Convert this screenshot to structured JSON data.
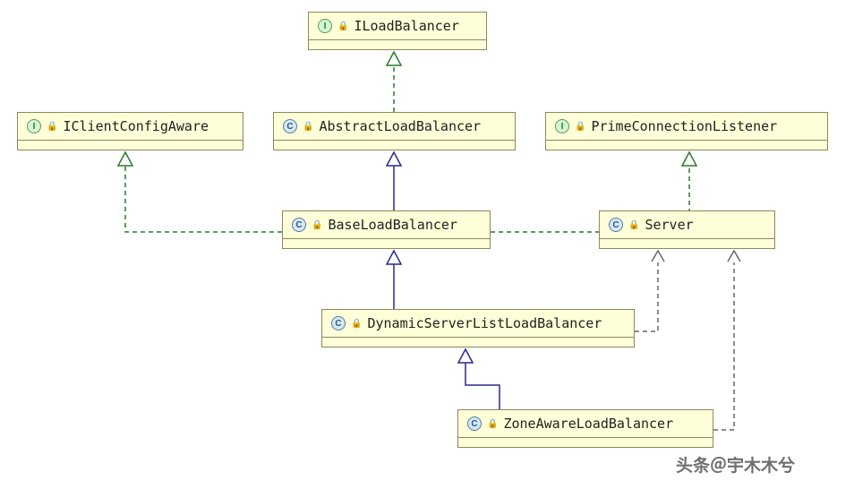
{
  "classes": {
    "iloadbalancer": {
      "label": "ILoadBalancer",
      "type": "interface"
    },
    "iclientconfigaware": {
      "label": "IClientConfigAware",
      "type": "interface"
    },
    "abstractloadbalancer": {
      "label": "AbstractLoadBalancer",
      "type": "class"
    },
    "primeconnectionlistener": {
      "label": "PrimeConnectionListener",
      "type": "interface"
    },
    "baseloadbalancer": {
      "label": "BaseLoadBalancer",
      "type": "class"
    },
    "server": {
      "label": "Server",
      "type": "class"
    },
    "dynamicserverlistloadbalancer": {
      "label": "DynamicServerListLoadBalancer",
      "type": "class"
    },
    "zoneawareloadbalancer": {
      "label": "ZoneAwareLoadBalancer",
      "type": "class"
    }
  },
  "relationships": [
    {
      "from": "AbstractLoadBalancer",
      "to": "ILoadBalancer",
      "type": "implements"
    },
    {
      "from": "BaseLoadBalancer",
      "to": "AbstractLoadBalancer",
      "type": "extends"
    },
    {
      "from": "BaseLoadBalancer",
      "to": "IClientConfigAware",
      "type": "implements"
    },
    {
      "from": "BaseLoadBalancer",
      "to": "PrimeConnectionListener",
      "type": "implements"
    },
    {
      "from": "DynamicServerListLoadBalancer",
      "to": "BaseLoadBalancer",
      "type": "extends"
    },
    {
      "from": "DynamicServerListLoadBalancer",
      "to": "Server",
      "type": "dependency"
    },
    {
      "from": "ZoneAwareLoadBalancer",
      "to": "DynamicServerListLoadBalancer",
      "type": "extends"
    },
    {
      "from": "ZoneAwareLoadBalancer",
      "to": "Server",
      "type": "dependency"
    }
  ],
  "watermark": "头条＠宇木木兮"
}
